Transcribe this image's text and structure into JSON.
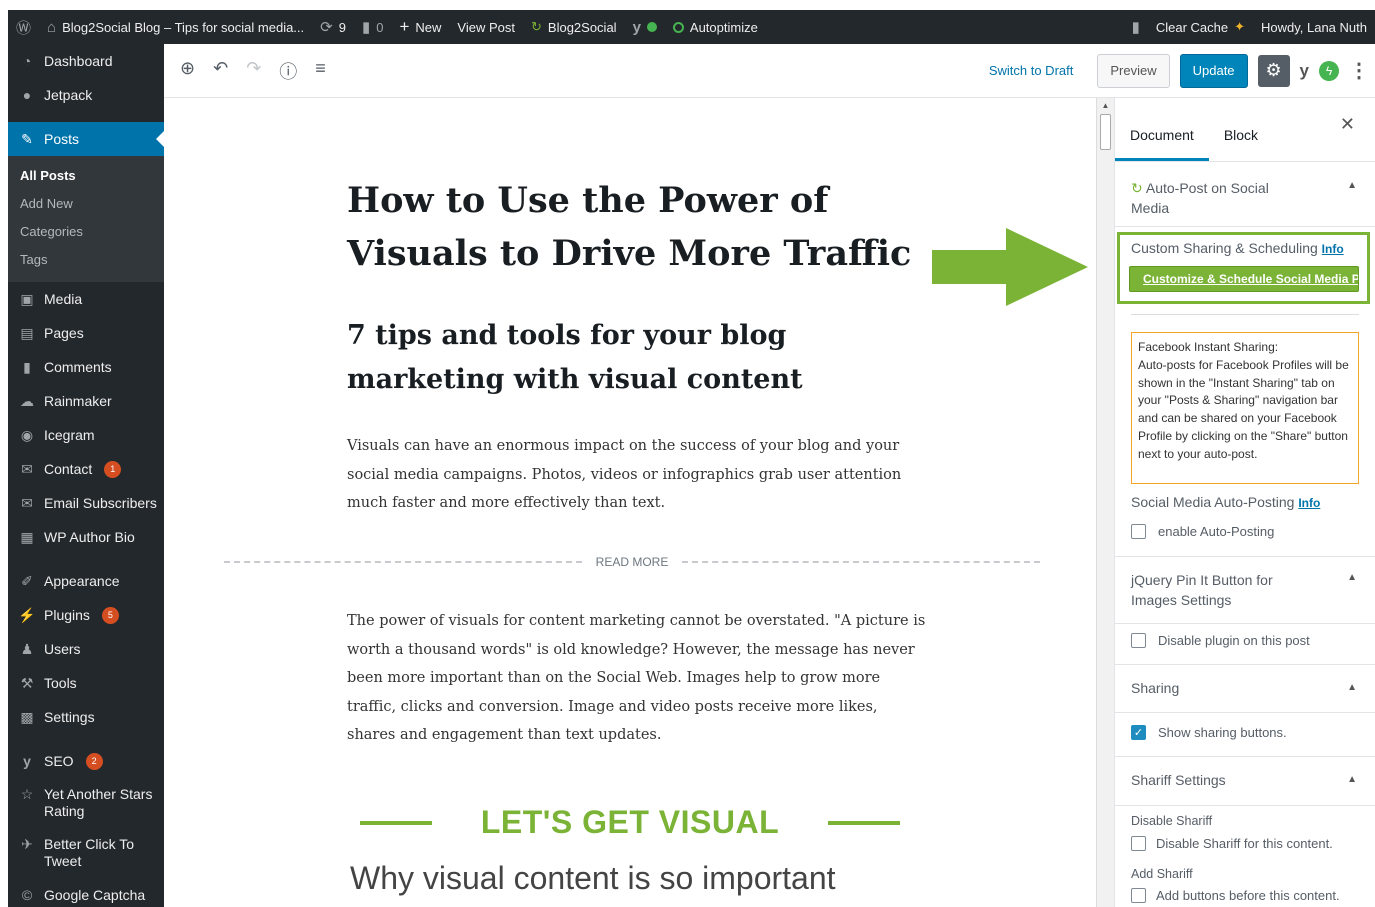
{
  "adminbar": {
    "wp_logo": "Ⓦ",
    "site": "Blog2Social Blog – Tips for social media...",
    "updates": "9",
    "comments": "0",
    "new": "New",
    "view_post": "View Post",
    "blog2social": "Blog2Social",
    "autoptimize": "Autoptimize",
    "clear_cache": "Clear Cache",
    "howdy": "Howdy, Lana Nuth"
  },
  "sidebar": {
    "dashboard": "Dashboard",
    "jetpack": "Jetpack",
    "posts": "Posts",
    "sub": [
      "All Posts",
      "Add New",
      "Categories",
      "Tags"
    ],
    "media": "Media",
    "pages": "Pages",
    "comments": "Comments",
    "rainmaker": "Rainmaker",
    "icegram": "Icegram",
    "contact": "Contact",
    "contact_badge": "1",
    "email_subscribers": "Email Subscribers",
    "wp_author_bio": "WP Author Bio",
    "appearance": "Appearance",
    "plugins": "Plugins",
    "plugins_badge": "5",
    "users": "Users",
    "tools": "Tools",
    "settings": "Settings",
    "seo": "SEO",
    "seo_badge": "2",
    "yasr_1": "Yet Another Stars",
    "yasr_2": "Rating",
    "bctt_1": "Better Click To",
    "bctt_2": "Tweet",
    "captcha": "Google Captcha"
  },
  "header": {
    "switch_to_draft": "Switch to Draft",
    "preview": "Preview",
    "update": "Update"
  },
  "post": {
    "title_1": "How to Use the Power of",
    "title_2": "Visuals to Drive More Traffic",
    "h2_1": "7 tips and tools for your blog",
    "h2_2": "marketing with visual content",
    "para1": "Visuals can have an enormous impact on the success of your blog and your social media campaigns.  Photos, videos or infographics grab user attention much faster and more effectively than text.",
    "read_more": "READ MORE",
    "para2": "The power of visuals for content marketing cannot be overstated. \"A picture is worth a thousand words\" is old knowledge? However, the message has never been more important than on the Social Web. Images help to grow more traffic, clicks and conversion. Image and video posts receive more likes, shares and engagement than text updates.",
    "visual_heading": "LET'S GET VISUAL",
    "why": "Why visual content is so important"
  },
  "panel": {
    "tab_document": "Document",
    "tab_block": "Block",
    "autopost_1": "Auto-Post on Social",
    "autopost_2": "Media",
    "custom_sharing": "Custom Sharing & Scheduling",
    "info": "Info",
    "customize_btn": "Customize & Schedule Social Media Po",
    "fb_title": "Facebook Instant Sharing:",
    "fb_text": "Auto-posts for Facebook Profiles will be shown in the \"Instant Sharing\" tab on your \"Posts & Sharing\" navigation bar and can be shared on your Facebook Profile by clicking on the \"Share\" button next to your auto-post.",
    "sma_posting": "Social Media Auto-Posting",
    "enable_autoposting": "enable Auto-Posting",
    "jquery_1": "jQuery Pin It Button for",
    "jquery_2": "Images Settings",
    "disable_plugin": "Disable plugin on this post",
    "sharing": "Sharing",
    "show_sharing": "Show sharing buttons.",
    "shariff_settings": "Shariff Settings",
    "disable_shariff": "Disable Shariff",
    "disable_shariff_cb": "Disable Shariff for this content.",
    "add_shariff": "Add Shariff",
    "add_shariff_cb": "Add buttons before this content."
  },
  "colors": {
    "accent": "#0085ba",
    "green": "#7ab335",
    "admin": "#23282d"
  }
}
